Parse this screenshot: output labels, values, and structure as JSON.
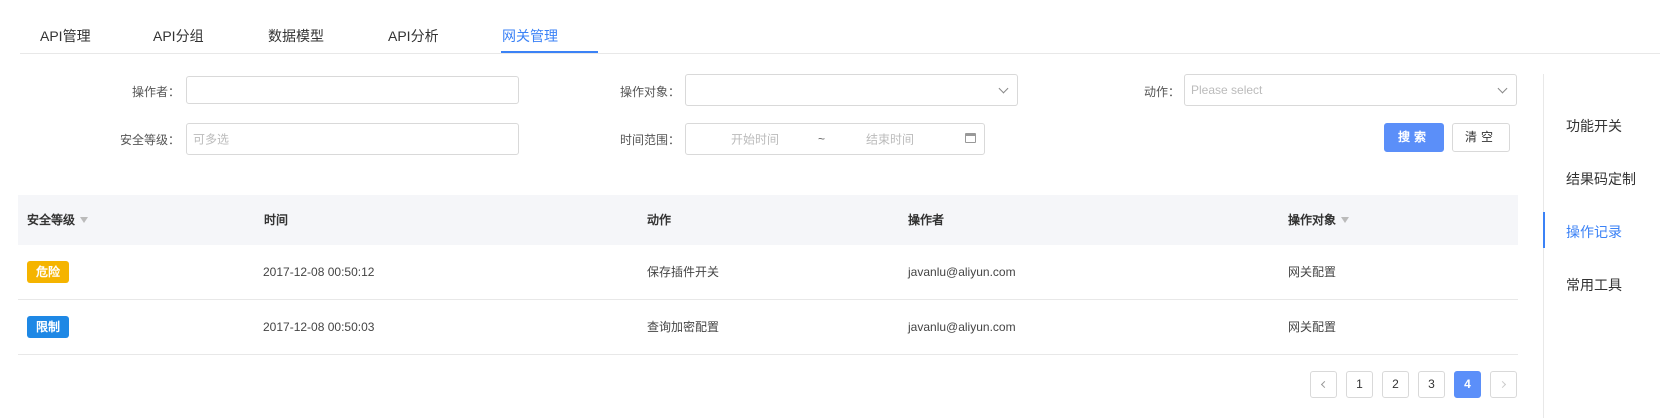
{
  "tabs": [
    {
      "label": "API管理"
    },
    {
      "label": "API分组"
    },
    {
      "label": "数据模型"
    },
    {
      "label": "API分析"
    },
    {
      "label": "网关管理",
      "active": true
    }
  ],
  "filters": {
    "operator_label": "操作者：",
    "operator_value": "",
    "target_label": "操作对象：",
    "target_value": "",
    "action_label": "动作：",
    "action_placeholder": "Please select",
    "level_label": "安全等级：",
    "level_placeholder": "可多选",
    "time_label": "时间范围：",
    "time_start_placeholder": "开始时间",
    "time_separator": "~",
    "time_end_placeholder": "结束时间",
    "search_button": "搜索",
    "clear_button": "清空"
  },
  "table": {
    "columns": [
      "安全等级",
      "时间",
      "动作",
      "操作者",
      "操作对象"
    ],
    "rows": [
      {
        "level": "危险",
        "level_color": "#f5b400",
        "time": "2017-12-08 00:50:12",
        "action": "保存插件开关",
        "operator": "javanlu@aliyun.com",
        "target": "网关配置"
      },
      {
        "level": "限制",
        "level_color": "#1e88e5",
        "time": "2017-12-08 00:50:03",
        "action": "查询加密配置",
        "operator": "javanlu@aliyun.com",
        "target": "网关配置"
      }
    ]
  },
  "pagination": {
    "pages": [
      "1",
      "2",
      "3",
      "4"
    ],
    "current": "4"
  },
  "side_nav": {
    "items": [
      {
        "label": "功能开关"
      },
      {
        "label": "结果码定制"
      },
      {
        "label": "操作记录",
        "active": true
      },
      {
        "label": "常用工具"
      }
    ]
  },
  "colors": {
    "accent": "#3b82f6",
    "primary_button": "#5b8ff9",
    "danger_badge": "#f5b400",
    "limit_badge": "#1e88e5"
  }
}
